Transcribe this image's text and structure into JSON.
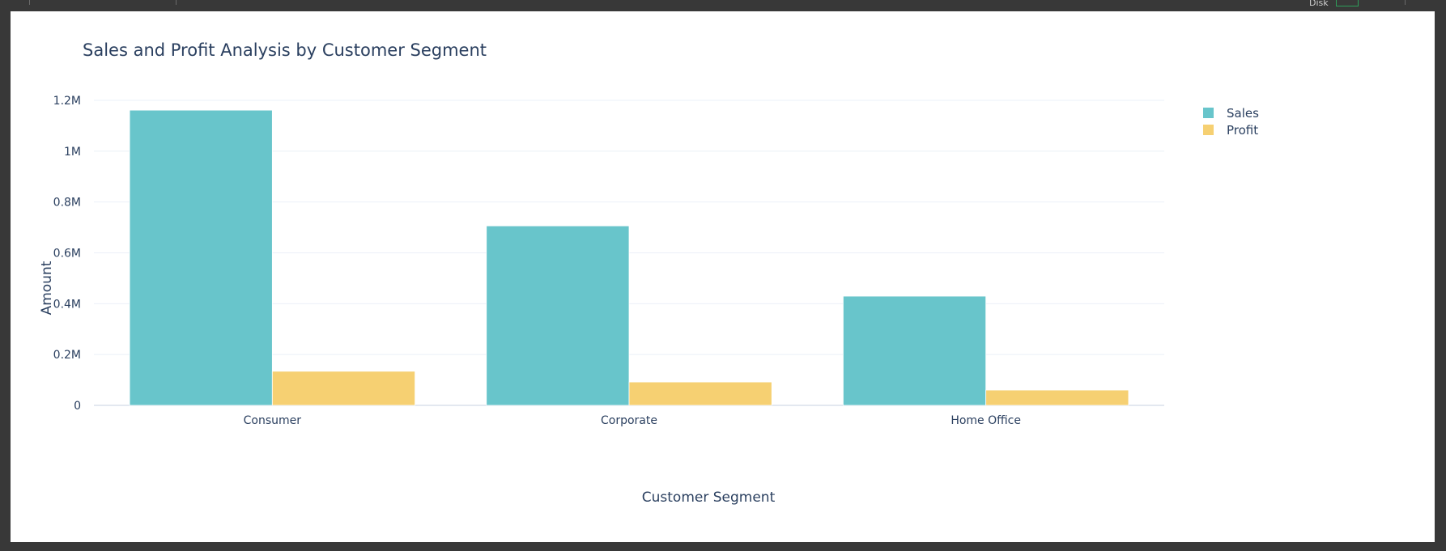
{
  "status_bar": {
    "disk_label": "Disk"
  },
  "chart_data": {
    "type": "bar",
    "title": "Sales and Profit Analysis by Customer Segment",
    "xlabel": "Customer Segment",
    "ylabel": "Amount",
    "categories": [
      "Consumer",
      "Corporate",
      "Home Office"
    ],
    "series": [
      {
        "name": "Sales",
        "color": "#68c5cb",
        "values": [
          1161401,
          706146,
          429653
        ]
      },
      {
        "name": "Profit",
        "color": "#f6d072",
        "values": [
          134119,
          91979,
          60299
        ]
      }
    ],
    "ylim": [
      0,
      1200000
    ],
    "yticks": [
      0,
      200000,
      400000,
      600000,
      800000,
      1000000,
      1200000
    ],
    "ytick_labels": [
      "0",
      "0.2M",
      "0.4M",
      "0.6M",
      "0.8M",
      "1M",
      "1.2M"
    ],
    "grid": true,
    "legend_position": "top-right"
  }
}
